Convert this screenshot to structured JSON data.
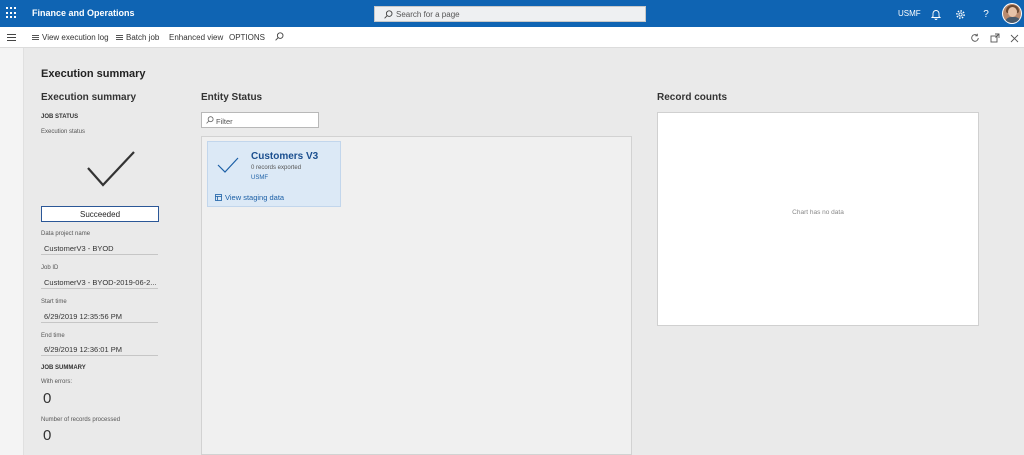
{
  "topbar": {
    "app_title": "Finance and Operations",
    "search_placeholder": "Search for a page",
    "company": "USMF",
    "icons": [
      "waffle-icon",
      "search-icon",
      "bell-icon",
      "gear-icon",
      "help-icon",
      "avatar"
    ]
  },
  "actionbar": {
    "items": [
      {
        "label": "View execution log",
        "icon": "list-icon"
      },
      {
        "label": "Batch job",
        "icon": "list-icon"
      },
      {
        "label": "Enhanced view"
      },
      {
        "label": "OPTIONS"
      }
    ],
    "right_icons": [
      "refresh-icon",
      "popout-icon",
      "close-icon"
    ]
  },
  "page": {
    "title": "Execution summary"
  },
  "summary": {
    "title": "Execution summary",
    "job_status_label": "JOB STATUS",
    "execution_status_label": "Execution status",
    "status": "Succeeded",
    "data_project_name_label": "Data project name",
    "data_project_name": "CustomerV3 - BYOD",
    "job_id_label": "Job ID",
    "job_id": "CustomerV3 - BYOD-2019-06-2...",
    "start_time_label": "Start time",
    "start_time": "6/29/2019 12:35:56 PM",
    "end_time_label": "End time",
    "end_time": "6/29/2019 12:36:01 PM",
    "job_summary_label": "JOB SUMMARY",
    "with_errors_label": "With errors:",
    "with_errors": "0",
    "records_processed_label": "Number of records processed",
    "records_processed": "0"
  },
  "entity_status": {
    "title": "Entity Status",
    "filter_placeholder": "Filter",
    "tiles": [
      {
        "name": "Customers V3",
        "records": "0 records exported",
        "company": "USMF",
        "link": "View staging data"
      }
    ]
  },
  "record_counts": {
    "title": "Record counts",
    "empty_message": "Chart has no data"
  },
  "colors": {
    "topbar": "#0f64b3",
    "tile_bg": "#dce9f6",
    "link": "#1b5fa6"
  }
}
